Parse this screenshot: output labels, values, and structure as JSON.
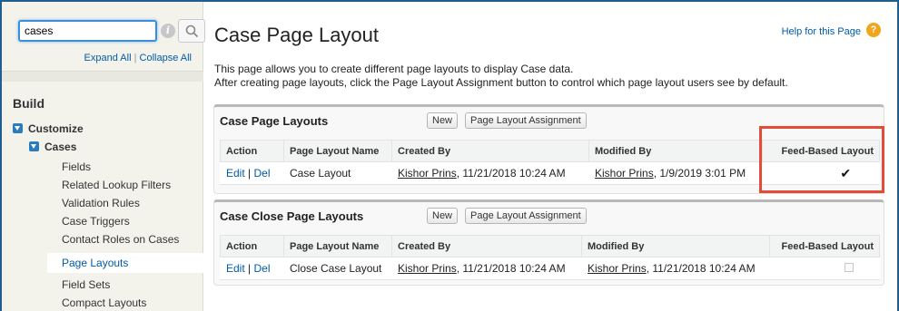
{
  "sidebar": {
    "search": {
      "value": "cases"
    },
    "expand_all": "Expand All",
    "separator": "|",
    "collapse_all": "Collapse All",
    "build_title": "Build",
    "customize": "Customize",
    "cases": "Cases",
    "items": [
      "Fields",
      "Related Lookup Filters",
      "Validation Rules",
      "Case Triggers",
      "Contact Roles on Cases",
      "Page Layouts",
      "Field Sets",
      "Compact Layouts"
    ]
  },
  "main": {
    "title": "Case Page Layout",
    "help_link": "Help for this Page",
    "description_line1": "This page allows you to create different page layouts to display Case data.",
    "description_line2": "After creating page layouts, click the Page Layout Assignment button to control which page layout users see by default.",
    "sections": [
      {
        "title": "Case Page Layouts",
        "new_button": "New",
        "assignment_button": "Page Layout Assignment",
        "columns": [
          "Action",
          "Page Layout Name",
          "Created By",
          "Modified By",
          "Feed-Based Layout"
        ],
        "row": {
          "edit": "Edit",
          "sep": "|",
          "del": "Del",
          "name": "Case Layout",
          "created_by_user": "Kishor Prins",
          "created_by_date": ", 11/21/2018 10:24 AM",
          "modified_by_user": "Kishor Prins",
          "modified_by_date": ", 1/9/2019 3:01 PM",
          "feed_based": "✔"
        }
      },
      {
        "title": "Case Close Page Layouts",
        "new_button": "New",
        "assignment_button": "Page Layout Assignment",
        "columns": [
          "Action",
          "Page Layout Name",
          "Created By",
          "Modified By",
          "Feed-Based Layout"
        ],
        "row": {
          "edit": "Edit",
          "sep": "|",
          "del": "Del",
          "name": "Close Case Layout",
          "created_by_user": "Kishor Prins",
          "created_by_date": ", 11/21/2018 10:24 AM",
          "modified_by_user": "Kishor Prins",
          "modified_by_date": ", 11/21/2018 10:24 AM",
          "feed_based": ""
        }
      }
    ]
  },
  "colors": {
    "link": "#015ba7",
    "highlight": "#e44c3a",
    "help_icon": "#f2a51a",
    "tree_toggle": "#2b7bbf"
  }
}
